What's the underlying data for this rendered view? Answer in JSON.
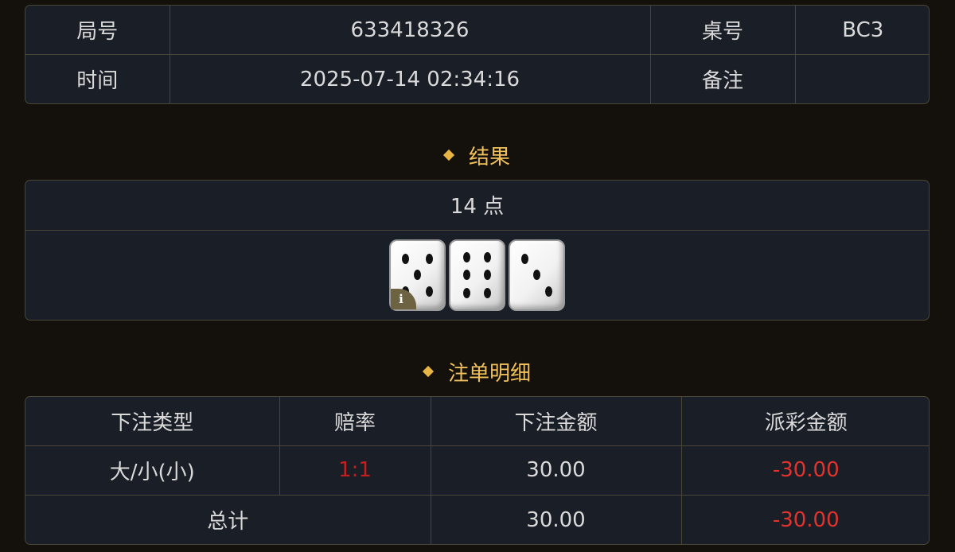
{
  "info": {
    "round_label": "局号",
    "round_value": "633418326",
    "table_label": "桌号",
    "table_value": "BC3",
    "time_label": "时间",
    "time_value": "2025-07-14 02:34:16",
    "note_label": "备注",
    "note_value": ""
  },
  "result": {
    "section_title": "结果",
    "points": "14 点",
    "dice": [
      5,
      6,
      3
    ]
  },
  "bets": {
    "section_title": "注单明细",
    "headers": [
      "下注类型",
      "赔率",
      "下注金额",
      "派彩金额"
    ],
    "rows": [
      {
        "type": "大/小(小)",
        "odds": "1:1",
        "amount": "30.00",
        "payout": "-30.00"
      }
    ],
    "total": {
      "label": "总计",
      "amount": "30.00",
      "payout": "-30.00"
    }
  },
  "colors": {
    "accent": "#f0c15a",
    "negative": "#e0332e",
    "border": "#4a4536",
    "panel": "#1a1e27"
  }
}
